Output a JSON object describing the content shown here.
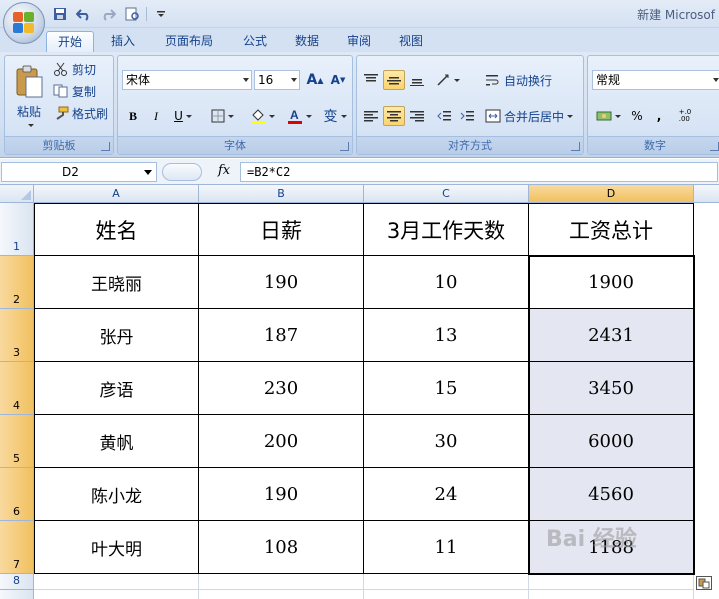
{
  "window": {
    "title": "新建 Microsof"
  },
  "tabs": [
    "开始",
    "插入",
    "页面布局",
    "公式",
    "数据",
    "审阅",
    "视图"
  ],
  "clipboard": {
    "paste": "粘贴",
    "cut": "剪切",
    "copy": "复制",
    "format_painter": "格式刷",
    "label": "剪贴板"
  },
  "font": {
    "name": "宋体",
    "size": "16",
    "label": "字体",
    "bold": "B",
    "italic": "I",
    "underline": "U",
    "grow": "A",
    "shrink": "A",
    "wen": "变"
  },
  "alignment": {
    "wrap": "自动换行",
    "merge": "合并后居中",
    "label": "对齐方式"
  },
  "number": {
    "format": "常规",
    "percent": "%",
    "comma": ",",
    "label": "数字",
    "inc": "+.0\n.00",
    "dec": ".00\n→.0"
  },
  "formula_bar": {
    "name_box": "D2",
    "fx": "fx",
    "formula": "=B2*C2"
  },
  "columns": [
    "A",
    "B",
    "C",
    "D"
  ],
  "rows": [
    "1",
    "2",
    "3",
    "4",
    "5",
    "6",
    "7",
    "8"
  ],
  "table": {
    "headers": [
      "姓名",
      "日薪",
      "3月工作天数",
      "工资总计"
    ],
    "rows": [
      [
        "王晓丽",
        "190",
        "10",
        "1900"
      ],
      [
        "张丹",
        "187",
        "13",
        "2431"
      ],
      [
        "彦语",
        "230",
        "15",
        "3450"
      ],
      [
        "黄帆",
        "200",
        "30",
        "6000"
      ],
      [
        "陈小龙",
        "190",
        "24",
        "4560"
      ],
      [
        "叶大明",
        "108",
        "11",
        "1188"
      ]
    ]
  },
  "watermark": "Bai 经验",
  "colors": {
    "selection_header": "#f1c15f",
    "selected_cells": "#e4e6f2",
    "ribbon": "#d1dff1"
  }
}
